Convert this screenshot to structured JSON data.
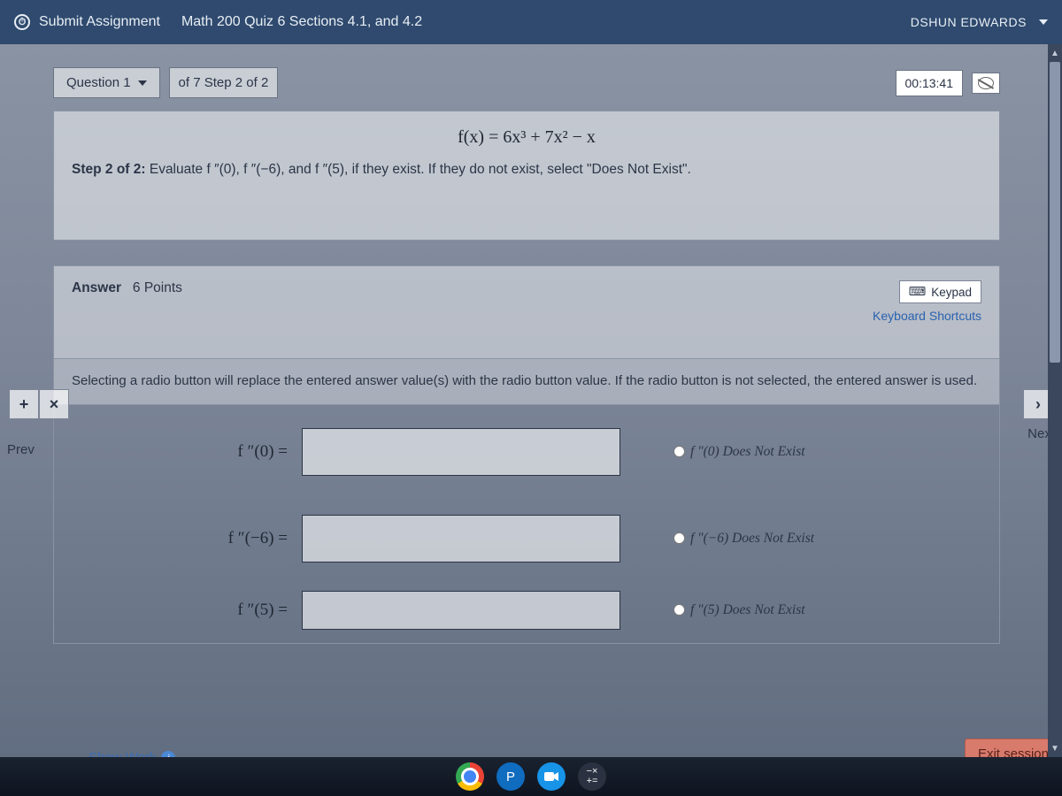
{
  "topbar": {
    "submit_label": "Submit Assignment",
    "app_title": "Math 200 Quiz 6 Sections 4.1, and 4.2",
    "user_name": "DSHUN EDWARDS"
  },
  "question": {
    "q_label": "Question 1",
    "of_text": "of 7 Step 2 of 2",
    "timer": "00:13:41",
    "formula": "f(x) = 6x³ + 7x² − x",
    "step_strong": "Step 2 of 2:",
    "step_rest": " Evaluate f ″(0), f ″(−6), and f ″(5), if they exist. If they do not exist, select \"Does Not Exist\"."
  },
  "answer": {
    "label_strong": "Answer",
    "points": "6 Points",
    "keypad_label": "Keypad",
    "shortcuts_label": "Keyboard Shortcuts",
    "hint": "Selecting a radio button will replace the entered answer value(s) with the radio button value. If the radio button is not selected, the entered answer is used.",
    "rows": [
      {
        "label": "f ″(0) =",
        "dne": "f ″(0) Does Not Exist"
      },
      {
        "label": "f ″(−6) =",
        "dne": "f ″(−6) Does Not Exist"
      },
      {
        "label": "f ″(5) =",
        "dne": "f ″(5) Does Not Exist"
      }
    ]
  },
  "nav": {
    "prev": "Prev",
    "next": "Next"
  },
  "footer": {
    "show_work": "Show Work",
    "exit": "Exit session"
  },
  "tools": {
    "plus": "+",
    "times": "×",
    "chevron_right": "›"
  }
}
